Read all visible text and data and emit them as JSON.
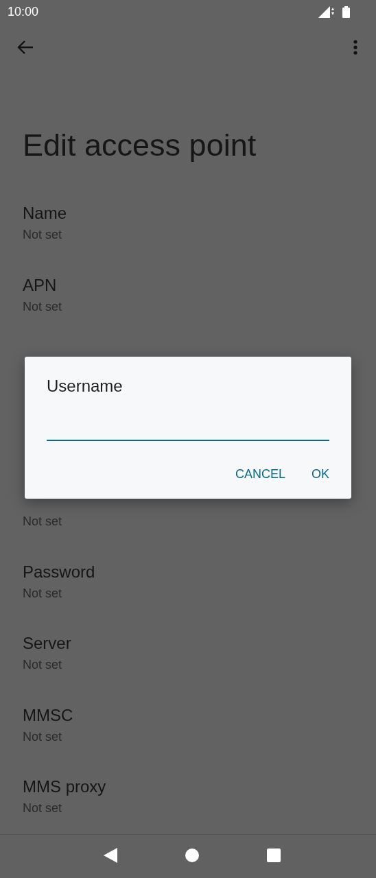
{
  "status_bar": {
    "time": "10:00"
  },
  "title": "Edit access point",
  "settings_above": [
    {
      "title": "Name",
      "value": "Not set"
    },
    {
      "title": "APN",
      "value": "Not set"
    }
  ],
  "settings_below": [
    {
      "value": "Not set"
    },
    {
      "title": "Password",
      "value": "Not set"
    },
    {
      "title": "Server",
      "value": "Not set"
    },
    {
      "title": "MMSC",
      "value": "Not set"
    },
    {
      "title": "MMS proxy",
      "value": "Not set"
    }
  ],
  "dialog": {
    "title": "Username",
    "buttons": [
      "CANCEL",
      "OK"
    ]
  }
}
